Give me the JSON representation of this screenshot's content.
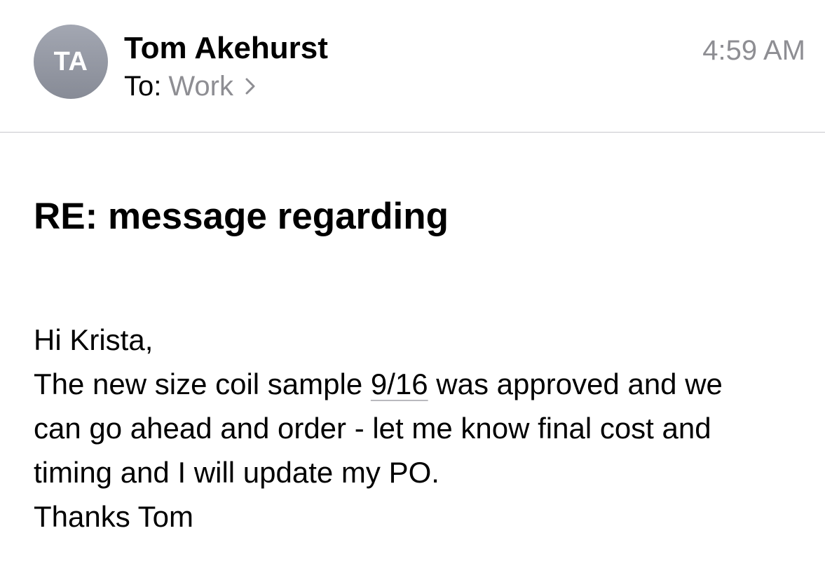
{
  "header": {
    "avatar_initials": "TA",
    "sender_name": "Tom Akehurst",
    "to_label": "To:",
    "to_value": "Work",
    "timestamp": "4:59 AM"
  },
  "message": {
    "subject": "RE: message regarding",
    "greeting": "Hi Krista,",
    "line2_before_date": "The new size coil sample ",
    "line2_date": "9/16",
    "line2_after_date": " was approved and we",
    "line3": "can go ahead and order - let me know final cost and",
    "line4": "timing and I will update my PO.",
    "signoff": "Thanks Tom"
  },
  "icons": {
    "recipient_disclosure": "chevron-right-icon"
  },
  "colors": {
    "secondary_text": "#8e8e93",
    "avatar_gradient_top": "#a3a7b2",
    "avatar_gradient_bottom": "#878b96",
    "divider": "#c8c8cc"
  }
}
